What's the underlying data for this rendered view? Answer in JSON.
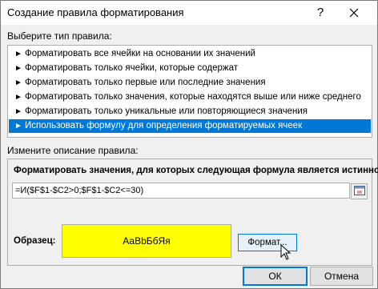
{
  "window": {
    "title": "Создание правила форматирования",
    "help_glyph": "?",
    "close_icon": "close-icon"
  },
  "rule_type": {
    "label": "Выберите тип правила:",
    "items": [
      {
        "label": "Форматировать все ячейки на основании их значений",
        "selected": false
      },
      {
        "label": "Форматировать только ячейки, которые содержат",
        "selected": false
      },
      {
        "label": "Форматировать только первые или последние значения",
        "selected": false
      },
      {
        "label": "Форматировать только значения, которые находятся выше или ниже среднего",
        "selected": false
      },
      {
        "label": "Форматировать только уникальные или повторяющиеся значения",
        "selected": false
      },
      {
        "label": "Использовать формулу для определения форматируемых ячеек",
        "selected": true
      }
    ],
    "item_arrow": "►"
  },
  "description": {
    "label": "Измените описание правила:",
    "heading": "Форматировать значения, для которых следующая формула является истинной:",
    "formula": "=И($F$1-$C2>0;$F$1-$C2<=30)",
    "preview_label": "Образец:",
    "preview_text": "АаВbБбЯя",
    "preview_fill": "#ffff00",
    "format_button": "Формат..."
  },
  "buttons": {
    "ok": "ОК",
    "cancel": "Отмена"
  },
  "colors": {
    "selection": "#0078d7",
    "accent_border": "#0078d7"
  }
}
